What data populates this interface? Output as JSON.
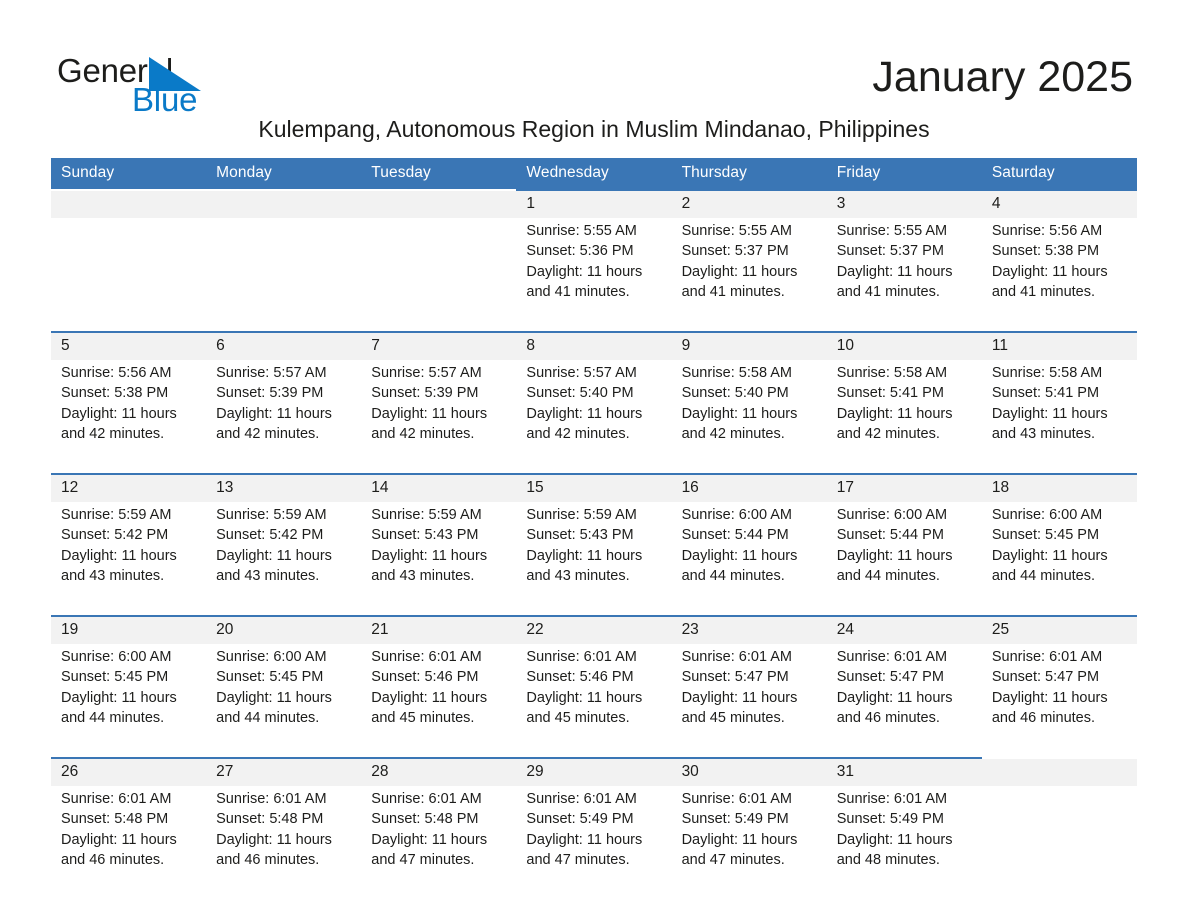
{
  "brand": {
    "name_part1": "General",
    "name_part2": "Blue",
    "logo_icon": "triangle-icon",
    "accent_color": "#0a7ac8",
    "header_color": "#3a76b5"
  },
  "header": {
    "month_title": "January 2025",
    "location_subtitle": "Kulempang, Autonomous Region in Muslim Mindanao, Philippines"
  },
  "calendar": {
    "weekday_headers": [
      "Sunday",
      "Monday",
      "Tuesday",
      "Wednesday",
      "Thursday",
      "Friday",
      "Saturday"
    ],
    "weeks": [
      [
        {
          "day": "",
          "lines": []
        },
        {
          "day": "",
          "lines": []
        },
        {
          "day": "",
          "lines": []
        },
        {
          "day": "1",
          "lines": [
            "Sunrise: 5:55 AM",
            "Sunset: 5:36 PM",
            "Daylight: 11 hours",
            "and 41 minutes."
          ]
        },
        {
          "day": "2",
          "lines": [
            "Sunrise: 5:55 AM",
            "Sunset: 5:37 PM",
            "Daylight: 11 hours",
            "and 41 minutes."
          ]
        },
        {
          "day": "3",
          "lines": [
            "Sunrise: 5:55 AM",
            "Sunset: 5:37 PM",
            "Daylight: 11 hours",
            "and 41 minutes."
          ]
        },
        {
          "day": "4",
          "lines": [
            "Sunrise: 5:56 AM",
            "Sunset: 5:38 PM",
            "Daylight: 11 hours",
            "and 41 minutes."
          ]
        }
      ],
      [
        {
          "day": "5",
          "lines": [
            "Sunrise: 5:56 AM",
            "Sunset: 5:38 PM",
            "Daylight: 11 hours",
            "and 42 minutes."
          ]
        },
        {
          "day": "6",
          "lines": [
            "Sunrise: 5:57 AM",
            "Sunset: 5:39 PM",
            "Daylight: 11 hours",
            "and 42 minutes."
          ]
        },
        {
          "day": "7",
          "lines": [
            "Sunrise: 5:57 AM",
            "Sunset: 5:39 PM",
            "Daylight: 11 hours",
            "and 42 minutes."
          ]
        },
        {
          "day": "8",
          "lines": [
            "Sunrise: 5:57 AM",
            "Sunset: 5:40 PM",
            "Daylight: 11 hours",
            "and 42 minutes."
          ]
        },
        {
          "day": "9",
          "lines": [
            "Sunrise: 5:58 AM",
            "Sunset: 5:40 PM",
            "Daylight: 11 hours",
            "and 42 minutes."
          ]
        },
        {
          "day": "10",
          "lines": [
            "Sunrise: 5:58 AM",
            "Sunset: 5:41 PM",
            "Daylight: 11 hours",
            "and 42 minutes."
          ]
        },
        {
          "day": "11",
          "lines": [
            "Sunrise: 5:58 AM",
            "Sunset: 5:41 PM",
            "Daylight: 11 hours",
            "and 43 minutes."
          ]
        }
      ],
      [
        {
          "day": "12",
          "lines": [
            "Sunrise: 5:59 AM",
            "Sunset: 5:42 PM",
            "Daylight: 11 hours",
            "and 43 minutes."
          ]
        },
        {
          "day": "13",
          "lines": [
            "Sunrise: 5:59 AM",
            "Sunset: 5:42 PM",
            "Daylight: 11 hours",
            "and 43 minutes."
          ]
        },
        {
          "day": "14",
          "lines": [
            "Sunrise: 5:59 AM",
            "Sunset: 5:43 PM",
            "Daylight: 11 hours",
            "and 43 minutes."
          ]
        },
        {
          "day": "15",
          "lines": [
            "Sunrise: 5:59 AM",
            "Sunset: 5:43 PM",
            "Daylight: 11 hours",
            "and 43 minutes."
          ]
        },
        {
          "day": "16",
          "lines": [
            "Sunrise: 6:00 AM",
            "Sunset: 5:44 PM",
            "Daylight: 11 hours",
            "and 44 minutes."
          ]
        },
        {
          "day": "17",
          "lines": [
            "Sunrise: 6:00 AM",
            "Sunset: 5:44 PM",
            "Daylight: 11 hours",
            "and 44 minutes."
          ]
        },
        {
          "day": "18",
          "lines": [
            "Sunrise: 6:00 AM",
            "Sunset: 5:45 PM",
            "Daylight: 11 hours",
            "and 44 minutes."
          ]
        }
      ],
      [
        {
          "day": "19",
          "lines": [
            "Sunrise: 6:00 AM",
            "Sunset: 5:45 PM",
            "Daylight: 11 hours",
            "and 44 minutes."
          ]
        },
        {
          "day": "20",
          "lines": [
            "Sunrise: 6:00 AM",
            "Sunset: 5:45 PM",
            "Daylight: 11 hours",
            "and 44 minutes."
          ]
        },
        {
          "day": "21",
          "lines": [
            "Sunrise: 6:01 AM",
            "Sunset: 5:46 PM",
            "Daylight: 11 hours",
            "and 45 minutes."
          ]
        },
        {
          "day": "22",
          "lines": [
            "Sunrise: 6:01 AM",
            "Sunset: 5:46 PM",
            "Daylight: 11 hours",
            "and 45 minutes."
          ]
        },
        {
          "day": "23",
          "lines": [
            "Sunrise: 6:01 AM",
            "Sunset: 5:47 PM",
            "Daylight: 11 hours",
            "and 45 minutes."
          ]
        },
        {
          "day": "24",
          "lines": [
            "Sunrise: 6:01 AM",
            "Sunset: 5:47 PM",
            "Daylight: 11 hours",
            "and 46 minutes."
          ]
        },
        {
          "day": "25",
          "lines": [
            "Sunrise: 6:01 AM",
            "Sunset: 5:47 PM",
            "Daylight: 11 hours",
            "and 46 minutes."
          ]
        }
      ],
      [
        {
          "day": "26",
          "lines": [
            "Sunrise: 6:01 AM",
            "Sunset: 5:48 PM",
            "Daylight: 11 hours",
            "and 46 minutes."
          ]
        },
        {
          "day": "27",
          "lines": [
            "Sunrise: 6:01 AM",
            "Sunset: 5:48 PM",
            "Daylight: 11 hours",
            "and 46 minutes."
          ]
        },
        {
          "day": "28",
          "lines": [
            "Sunrise: 6:01 AM",
            "Sunset: 5:48 PM",
            "Daylight: 11 hours",
            "and 47 minutes."
          ]
        },
        {
          "day": "29",
          "lines": [
            "Sunrise: 6:01 AM",
            "Sunset: 5:49 PM",
            "Daylight: 11 hours",
            "and 47 minutes."
          ]
        },
        {
          "day": "30",
          "lines": [
            "Sunrise: 6:01 AM",
            "Sunset: 5:49 PM",
            "Daylight: 11 hours",
            "and 47 minutes."
          ]
        },
        {
          "day": "31",
          "lines": [
            "Sunrise: 6:01 AM",
            "Sunset: 5:49 PM",
            "Daylight: 11 hours",
            "and 48 minutes."
          ]
        },
        {
          "day": "",
          "lines": []
        }
      ]
    ]
  }
}
